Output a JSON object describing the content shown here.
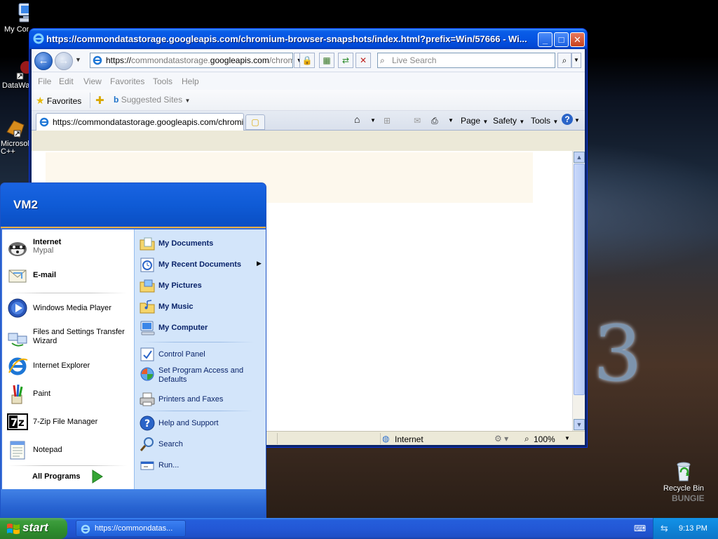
{
  "desktop": {
    "icons": [
      {
        "label": "My Com"
      },
      {
        "label": "DataWa"
      },
      {
        "label": "Microsol\nC++"
      }
    ],
    "recycle_bin": {
      "label": "Recycle Bin"
    },
    "wallpaper_text": "3",
    "wallpaper_brand": "BUNGIE"
  },
  "ie": {
    "title": "https://commondatastorage.googleapis.com/chromium-browser-snapshots/index.html?prefix=Win/57666 - Wi...",
    "address_prefix": "https://",
    "address_dim": "commondatastorage.",
    "address_host": "googleapis.com",
    "address_tail": "/chromi",
    "search_placeholder": "Live Search",
    "menu": [
      "File",
      "Edit",
      "View",
      "Favorites",
      "Tools",
      "Help"
    ],
    "favorites_label": "Favorites",
    "suggested_sites": "Suggested Sites",
    "tab_title": "https://commondatastorage.googleapis.com/chromiu...",
    "commands": {
      "page": "Page",
      "safety": "Safety",
      "tools": "Tools"
    },
    "status_zone": "Internet",
    "zoom": "100%"
  },
  "startmenu": {
    "user": "VM2",
    "pinned": [
      {
        "name": "Internet",
        "sub": "Mypal"
      },
      {
        "name": "E-mail",
        "sub": ""
      }
    ],
    "recent": [
      "Windows Media Player",
      "Files and Settings Transfer Wizard",
      "Internet Explorer",
      "Paint",
      "7-Zip File Manager",
      "Notepad"
    ],
    "all_programs": "All Programs",
    "places": [
      "My Documents",
      "My Recent Documents",
      "My Pictures",
      "My Music",
      "My Computer"
    ],
    "settings": [
      "Control Panel",
      "Set Program Access and Defaults",
      "Printers and Faxes"
    ],
    "help": [
      "Help and Support",
      "Search",
      "Run..."
    ]
  },
  "taskbar": {
    "start": "start",
    "task": "https://commondatas...",
    "clock": "9:13 PM"
  }
}
